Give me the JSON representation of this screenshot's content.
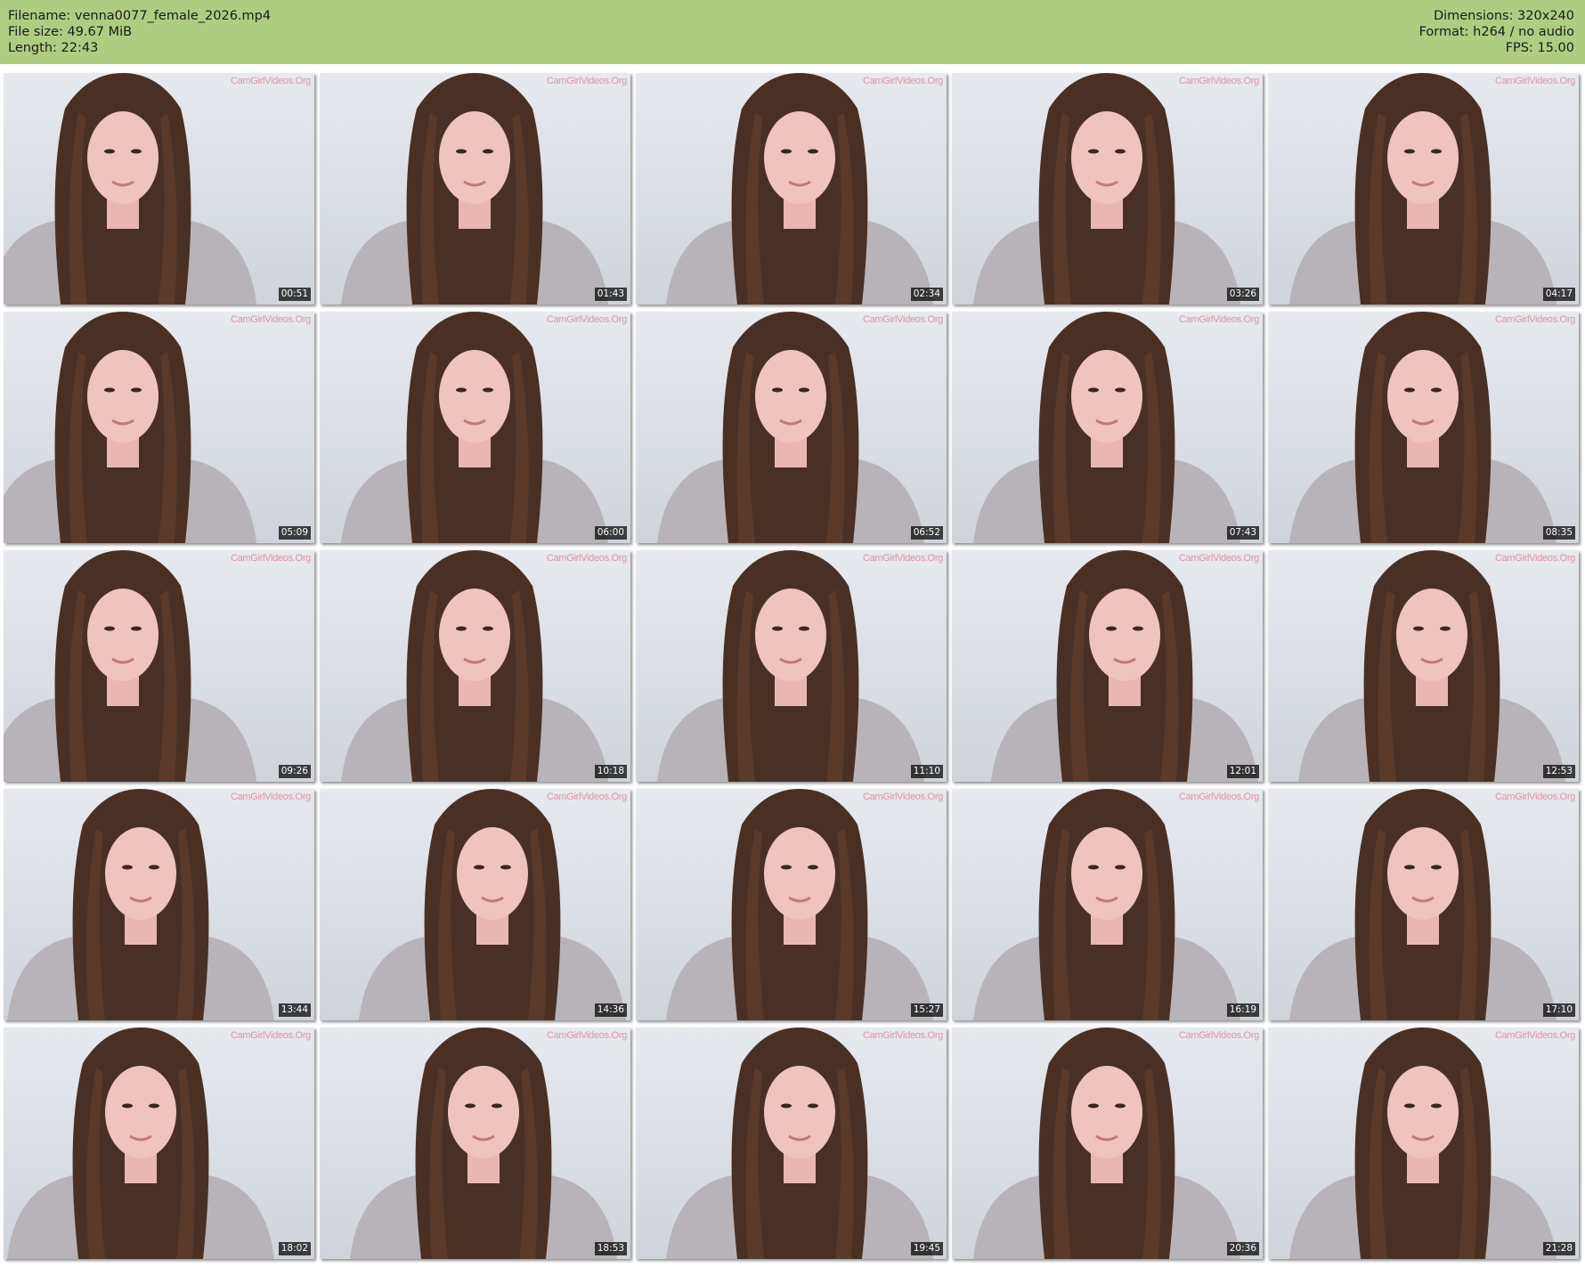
{
  "header": {
    "filename_label": "Filename: venna0077_female_2026.mp4",
    "filesize_label": "File size: 49.67 MiB",
    "length_label": "Length: 22:43",
    "dimensions_label": "Dimensions: 320x240",
    "format_label": "Format: h264 / no audio",
    "fps_label": "FPS: 15.00",
    "background_color": "#afcd80"
  },
  "watermark_text": "CamGirlVideos.Org",
  "thumbnails": [
    {
      "timestamp": "00:51"
    },
    {
      "timestamp": "01:43"
    },
    {
      "timestamp": "02:34"
    },
    {
      "timestamp": "03:26"
    },
    {
      "timestamp": "04:17"
    },
    {
      "timestamp": "05:09"
    },
    {
      "timestamp": "06:00"
    },
    {
      "timestamp": "06:52"
    },
    {
      "timestamp": "07:43"
    },
    {
      "timestamp": "08:35"
    },
    {
      "timestamp": "09:26"
    },
    {
      "timestamp": "10:18"
    },
    {
      "timestamp": "11:10"
    },
    {
      "timestamp": "12:01"
    },
    {
      "timestamp": "12:53"
    },
    {
      "timestamp": "13:44"
    },
    {
      "timestamp": "14:36"
    },
    {
      "timestamp": "15:27"
    },
    {
      "timestamp": "16:19"
    },
    {
      "timestamp": "17:10"
    },
    {
      "timestamp": "18:02"
    },
    {
      "timestamp": "18:53"
    },
    {
      "timestamp": "19:45"
    },
    {
      "timestamp": "20:36"
    },
    {
      "timestamp": "21:28"
    }
  ]
}
